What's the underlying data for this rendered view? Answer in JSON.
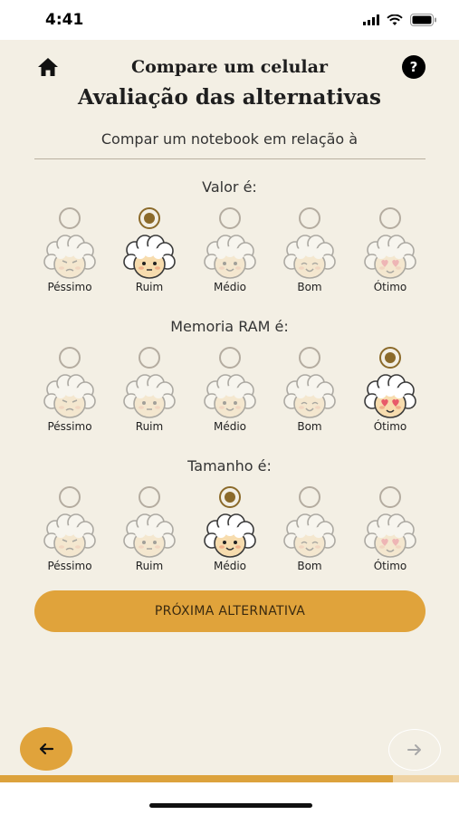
{
  "status": {
    "time": "4:41"
  },
  "header": {
    "title": "Compare um celular",
    "help": "?"
  },
  "subtitle": "Avaliação das alternativas",
  "compare_text": "Compar um notebook em relação à",
  "scale_labels": [
    "Péssimo",
    "Ruim",
    "Médio",
    "Bom",
    "Ótimo"
  ],
  "criteria": [
    {
      "label": "Valor é:",
      "selected": "Ruim"
    },
    {
      "label": "Memoria RAM é:",
      "selected": "Ótimo"
    },
    {
      "label": "Tamanho é:",
      "selected": "Médio"
    }
  ],
  "buttons": {
    "next_alternative": "PRÓXIMA ALTERNATIVA"
  },
  "progress": 0.857,
  "colors": {
    "accent": "#e0a33b",
    "background": "#f3efe4",
    "radio_selected": "#8b6a2a"
  }
}
